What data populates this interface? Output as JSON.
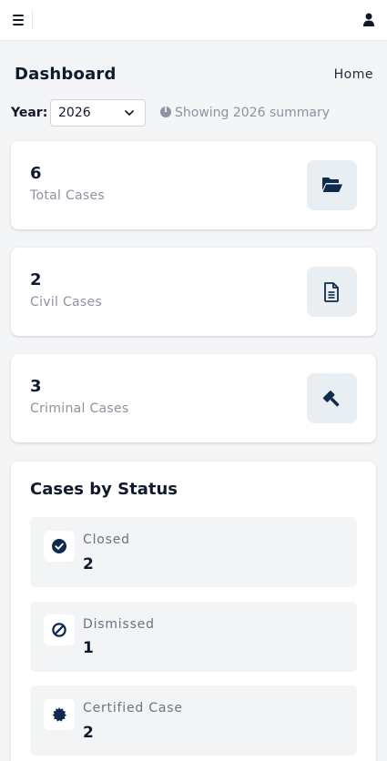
{
  "page": {
    "title": "Dashboard",
    "breadcrumb": "Home"
  },
  "filter": {
    "year_label": "Year:",
    "year_value": "2026",
    "hint": "Showing 2026 summary"
  },
  "stats": [
    {
      "value": "6",
      "label": "Total Cases",
      "icon": "folder-open-icon"
    },
    {
      "value": "2",
      "label": "Civil Cases",
      "icon": "document-icon"
    },
    {
      "value": "3",
      "label": "Criminal Cases",
      "icon": "gavel-icon"
    }
  ],
  "status_section": {
    "title": "Cases by Status",
    "items": [
      {
        "label": "Closed",
        "value": "2",
        "icon": "check-circle-icon"
      },
      {
        "label": "Dismissed",
        "value": "1",
        "icon": "ban-icon"
      },
      {
        "label": "Certified Case",
        "value": "2",
        "icon": "certificate-icon"
      }
    ]
  },
  "colors": {
    "accent": "#0f2a4f",
    "muted_text": "#8b93a1",
    "icon_box_bg": "#e8eef1",
    "page_bg": "#f4f5f7"
  }
}
